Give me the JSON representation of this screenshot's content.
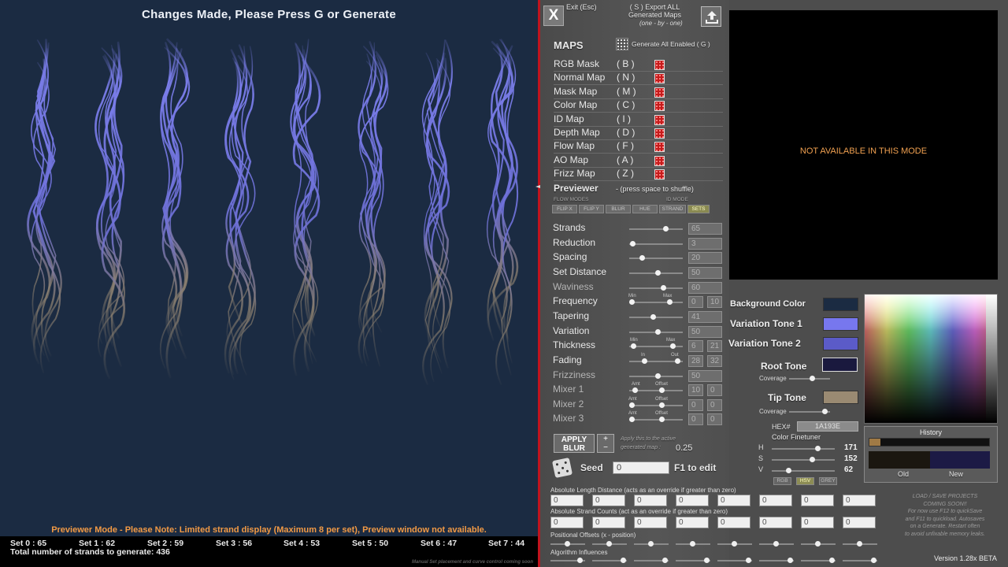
{
  "preview": {
    "banner": "Changes Made, Please Press G or Generate",
    "notice": "Previewer Mode - Please Note: Limited strand display (Maximum 8 per set), Preview window not available.",
    "sets": [
      "Set 0 : 65",
      "Set 1 : 62",
      "Set 2 : 59",
      "Set 3 : 56",
      "Set 4 : 53",
      "Set 5 : 50",
      "Set 6 : 47",
      "Set 7 : 44"
    ],
    "total": "Total number of strands to generate: 436",
    "footer_note": "Manual Set placement and curve control coming soon",
    "colors": {
      "background": "#1b2b42",
      "strand_top": "#7a7dea",
      "strand_bottom": "#8c8070"
    }
  },
  "toolbar": {
    "close_label": "X",
    "exit_label": "Exit (Esc)",
    "export_label_1": "( S ) Export ALL",
    "export_label_2": "Generated Maps",
    "export_sub": "(one - by - one)"
  },
  "maps": {
    "title": "MAPS",
    "generate_all": "Generate All Enabled ( G )",
    "items": [
      {
        "name": "RGB Mask",
        "key": "( B )"
      },
      {
        "name": "Normal Map",
        "key": "( N )"
      },
      {
        "name": "Mask Map",
        "key": "( M )"
      },
      {
        "name": "Color Map",
        "key": "( C )"
      },
      {
        "name": "ID Map",
        "key": "( I )"
      },
      {
        "name": "Depth Map",
        "key": "( D )"
      },
      {
        "name": "Flow Map",
        "key": "( F )"
      },
      {
        "name": "AO Map",
        "key": "( A )"
      },
      {
        "name": "Frizz Map",
        "key": "( Z )"
      }
    ]
  },
  "previewer": {
    "label": "Previewer",
    "hint": "- (press space to shuffle)",
    "flow_modes": "FLOW MODES",
    "id_mode": "ID MODE",
    "mode_buttons": [
      "FLIP X",
      "FLIP Y",
      "BLUR",
      "HUE",
      "STRAND",
      "SETS"
    ],
    "active_mode": "SETS"
  },
  "params": [
    {
      "name": "Strands",
      "values": [
        "65"
      ]
    },
    {
      "name": "Reduction",
      "values": [
        "3"
      ]
    },
    {
      "name": "Spacing",
      "values": [
        "20"
      ]
    },
    {
      "name": "Set Distance",
      "values": [
        "50"
      ]
    },
    {
      "name": "Waviness",
      "values": [
        "60"
      ]
    },
    {
      "name": "Frequency",
      "values": [
        "0",
        "10"
      ],
      "sub": [
        "Min",
        "Max"
      ]
    },
    {
      "name": "Tapering",
      "values": [
        "41"
      ]
    },
    {
      "name": "Variation",
      "values": [
        "50"
      ]
    },
    {
      "name": "Thickness",
      "values": [
        "6",
        "21"
      ],
      "sub": [
        "Min",
        "Max"
      ]
    },
    {
      "name": "Fading",
      "values": [
        "28",
        "32"
      ],
      "sub": [
        "In",
        "Out"
      ]
    },
    {
      "name": "Frizziness",
      "values": [
        "50"
      ]
    },
    {
      "name": "Mixer 1",
      "values": [
        "10",
        "0"
      ],
      "sub": [
        "Amt",
        "Offset"
      ]
    },
    {
      "name": "Mixer 2",
      "values": [
        "0",
        "0"
      ],
      "sub": [
        "Amt",
        "Offset"
      ]
    },
    {
      "name": "Mixer 3",
      "values": [
        "0",
        "0"
      ],
      "sub": [
        "Amt",
        "Offset"
      ]
    }
  ],
  "blur": {
    "apply_label_1": "APPLY",
    "apply_label_2": "BLUR",
    "plus": "+",
    "minus": "−",
    "hint_1": "Apply this to the active",
    "hint_2": "generated map :",
    "value": "0.25"
  },
  "seed": {
    "label": "Seed",
    "value": "0",
    "f1_hint": "F1 to edit"
  },
  "strips": {
    "length_title": "Absolute Length Distance (acts as an override if greater than zero)",
    "length_values": [
      "0",
      "0",
      "0",
      "0",
      "0",
      "0",
      "0",
      "0"
    ],
    "count_title": "Absolute Strand Counts (act as an override if greater than zero)",
    "count_values": [
      "0",
      "0",
      "0",
      "0",
      "0",
      "0",
      "0",
      "0"
    ],
    "offsets_title": "Positional Offsets (x - position)",
    "algorithm_title": "Algorithm Influences"
  },
  "right": {
    "na_text": "NOT AVAILABLE IN THIS MODE",
    "background_color": {
      "label": "Background Color",
      "hex": "#1b2b42"
    },
    "variation_tone_1": {
      "label": "Variation Tone 1",
      "hex": "#7777ee"
    },
    "variation_tone_2": {
      "label": "Variation Tone 2",
      "hex": "#5b5bc8"
    },
    "root_tone": {
      "label": "Root Tone",
      "hex": "#1a193e"
    },
    "tip_tone": {
      "label": "Tip Tone",
      "hex": "#9a8a72"
    },
    "coverage_label": "Coverage",
    "hex_label": "HEX#",
    "hex_value": "1A193E",
    "finetuner_label": "Color Finetuner",
    "hsv": [
      {
        "letter": "H",
        "value": "171"
      },
      {
        "letter": "S",
        "value": "152"
      },
      {
        "letter": "V",
        "value": "62"
      }
    ],
    "color_modes": [
      "RGB",
      "HSV",
      "GREY"
    ],
    "active_color_mode": "HSV",
    "history_title": "History",
    "old_label": "Old",
    "new_label": "New",
    "load_save_note": [
      "LOAD / SAVE PROJECTS",
      "COMING SOON!!",
      "For now use F12 to quickSave",
      "and F11 to quickload. Autosaves",
      "on a Generate. Restart often",
      "to avoid unfixable memory leaks."
    ],
    "version": "Version 1.28x BETA"
  }
}
